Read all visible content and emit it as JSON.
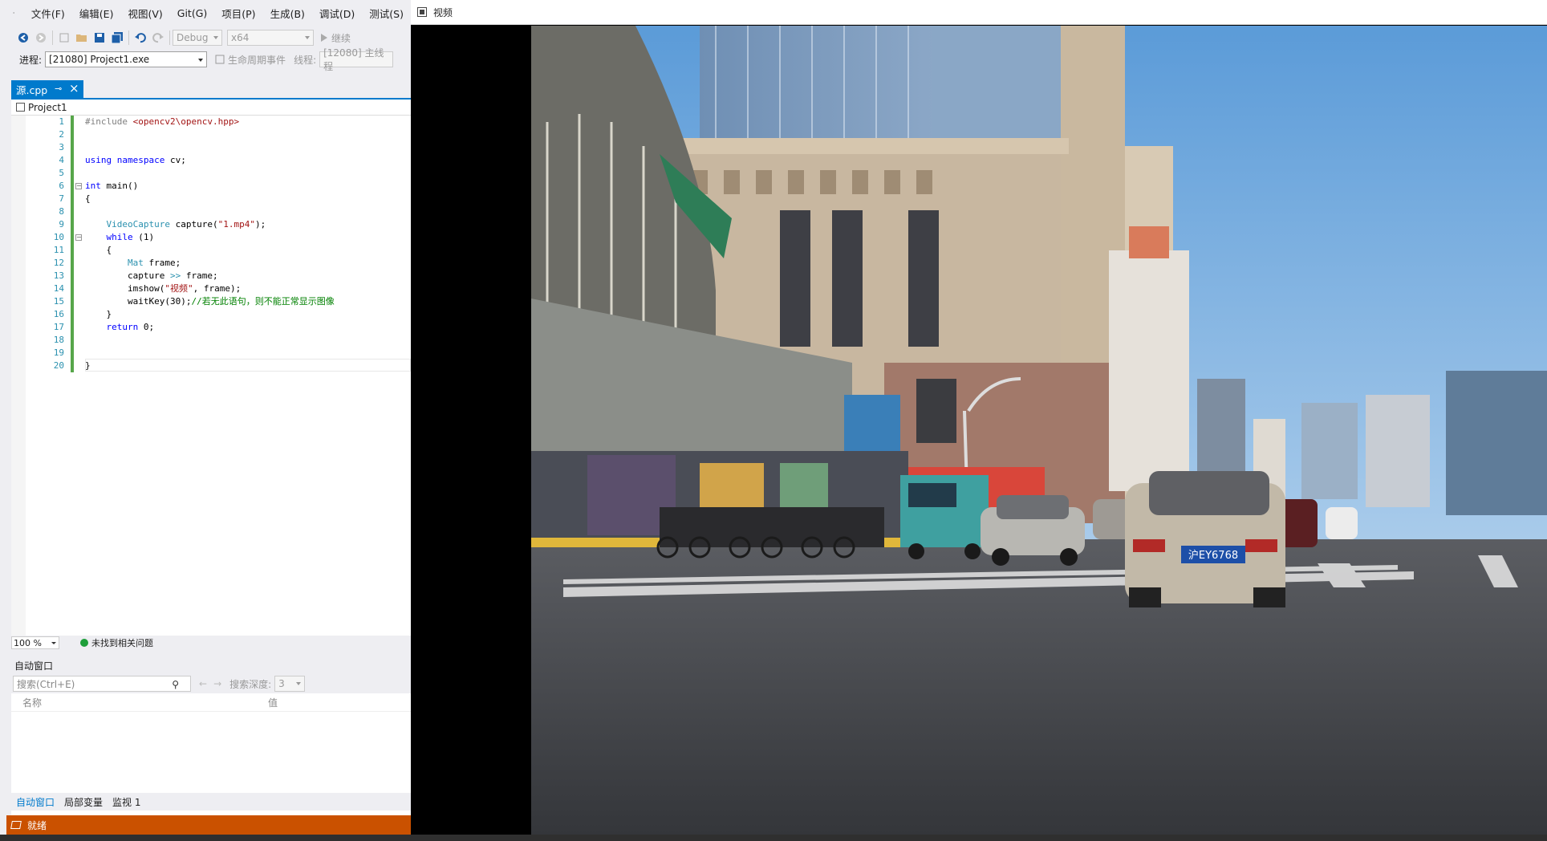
{
  "menubar": {
    "items": [
      "文件(F)",
      "编辑(E)",
      "视图(V)",
      "Git(G)",
      "项目(P)",
      "生成(B)",
      "调试(D)",
      "测试(S)"
    ]
  },
  "toolbar": {
    "config": "Debug",
    "platform": "x64",
    "continue_label": "继续"
  },
  "debug_toolbar": {
    "process_label": "进程:",
    "process_value": "[21080] Project1.exe",
    "lifecycle_label": "生命周期事件",
    "thread_label": "线程:",
    "thread_value": "[12080] 主线程"
  },
  "editor": {
    "tab_name": "源.cpp",
    "project": "Project1",
    "line_numbers": [
      "1",
      "2",
      "3",
      "4",
      "5",
      "6",
      "7",
      "8",
      "9",
      "10",
      "11",
      "12",
      "13",
      "14",
      "15",
      "16",
      "17",
      "18",
      "19",
      "20"
    ],
    "code": {
      "l1_pp": "#include ",
      "l1_path": "<opencv2\\opencv.hpp>",
      "l4_kw": "using namespace",
      "l4_rest": " cv;",
      "l6_kw": "int",
      "l6_rest": " main()",
      "l7": "{",
      "l9_type": "VideoCapture",
      "l9_rest": " capture(",
      "l9_str": "\"1.mp4\"",
      "l9_end": ");",
      "l10_kw": "while",
      "l10_rest": " (1)",
      "l11": "{",
      "l12_type": "Mat",
      "l12_rest": " frame;",
      "l13_a": "capture ",
      "l13_op": ">>",
      "l13_b": " frame;",
      "l14_a": "imshow(",
      "l14_str": "\"视频\"",
      "l14_b": ", frame);",
      "l15_a": "waitKey(30);",
      "l15_cm": "//若无此语句，则不能正常显示图像",
      "l16": "}",
      "l17_kw": "return",
      "l17_rest": " 0;",
      "l20": "}"
    },
    "zoom": "100 %",
    "issues": "未找到相关问题"
  },
  "autos": {
    "title": "自动窗口",
    "search_placeholder": "搜索(Ctrl+E)",
    "search_depth_label": "搜索深度:",
    "search_depth_value": "3",
    "col_name": "名称",
    "col_value": "值",
    "tabs": [
      "自动窗口",
      "局部变量",
      "监视 1"
    ]
  },
  "statusbar": {
    "text": "就绪",
    "color": "#ca5100"
  },
  "video_window": {
    "title": "视频",
    "plate": "沪EY6768"
  },
  "colors": {
    "accent": "#007acc",
    "keyword": "#0000ff",
    "type": "#2b91af",
    "string": "#a31515",
    "comment": "#008000"
  }
}
